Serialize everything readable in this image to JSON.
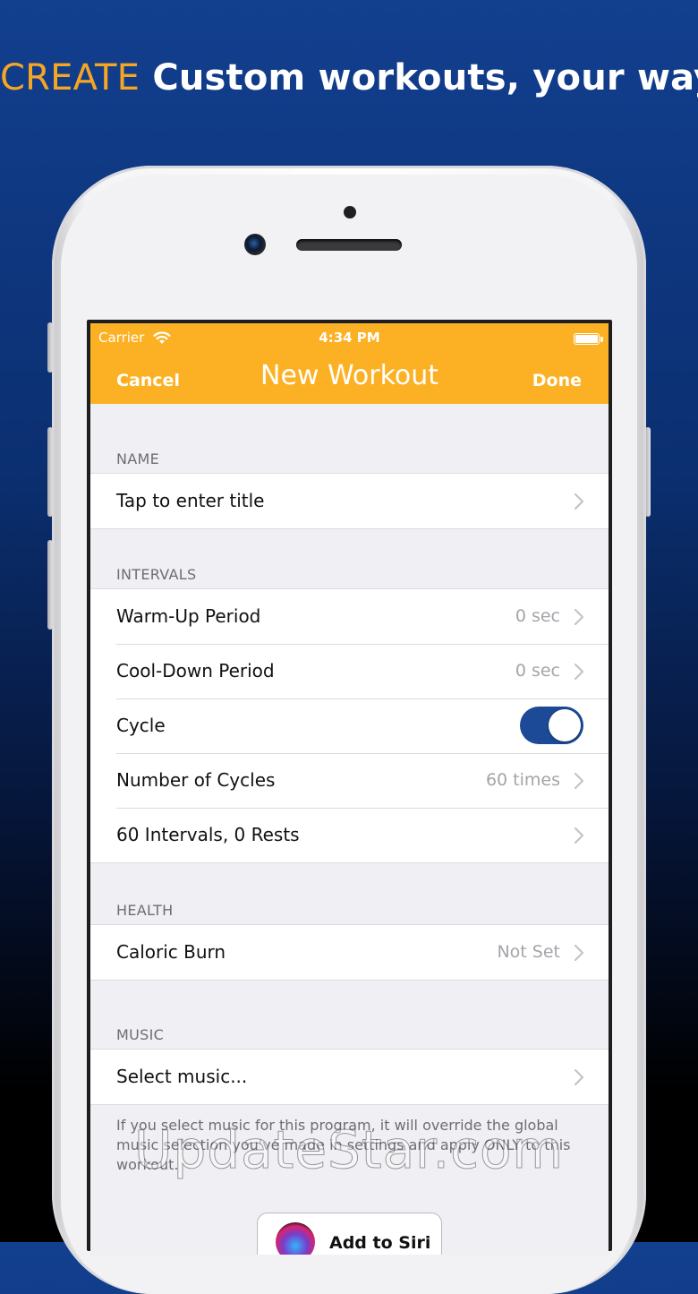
{
  "banner": {
    "accent": "CREATE",
    "text": "Custom workouts, your way"
  },
  "status_bar": {
    "carrier": "Carrier",
    "time": "4:34 PM"
  },
  "navbar": {
    "cancel": "Cancel",
    "title": "New Workout",
    "done": "Done",
    "color": "#FCB124"
  },
  "sections": {
    "name": {
      "header": "NAME",
      "title_row": "Tap to enter title"
    },
    "intervals": {
      "header": "INTERVALS",
      "warmup_label": "Warm-Up Period",
      "warmup_value": "0 sec",
      "cooldown_label": "Cool-Down Period",
      "cooldown_value": "0 sec",
      "cycle_label": "Cycle",
      "cycle_on": true,
      "cycles_label": "Number of Cycles",
      "cycles_value": "60 times",
      "summary": "60 Intervals, 0 Rests"
    },
    "health": {
      "header": "HEALTH",
      "caloric_label": "Caloric Burn",
      "caloric_value": "Not Set"
    },
    "music": {
      "header": "MUSIC",
      "select_label": "Select music...",
      "footnote": "If you select music for this program, it will override the global music selection you've made in settings and apply ONLY to this workout."
    }
  },
  "siri": {
    "label": "Add to Siri"
  },
  "watermark": "UpdateStar.com",
  "icons": {
    "wifi": "wifi-icon",
    "battery": "battery-icon",
    "chevron": "chevron-right-icon",
    "siri": "siri-icon"
  }
}
